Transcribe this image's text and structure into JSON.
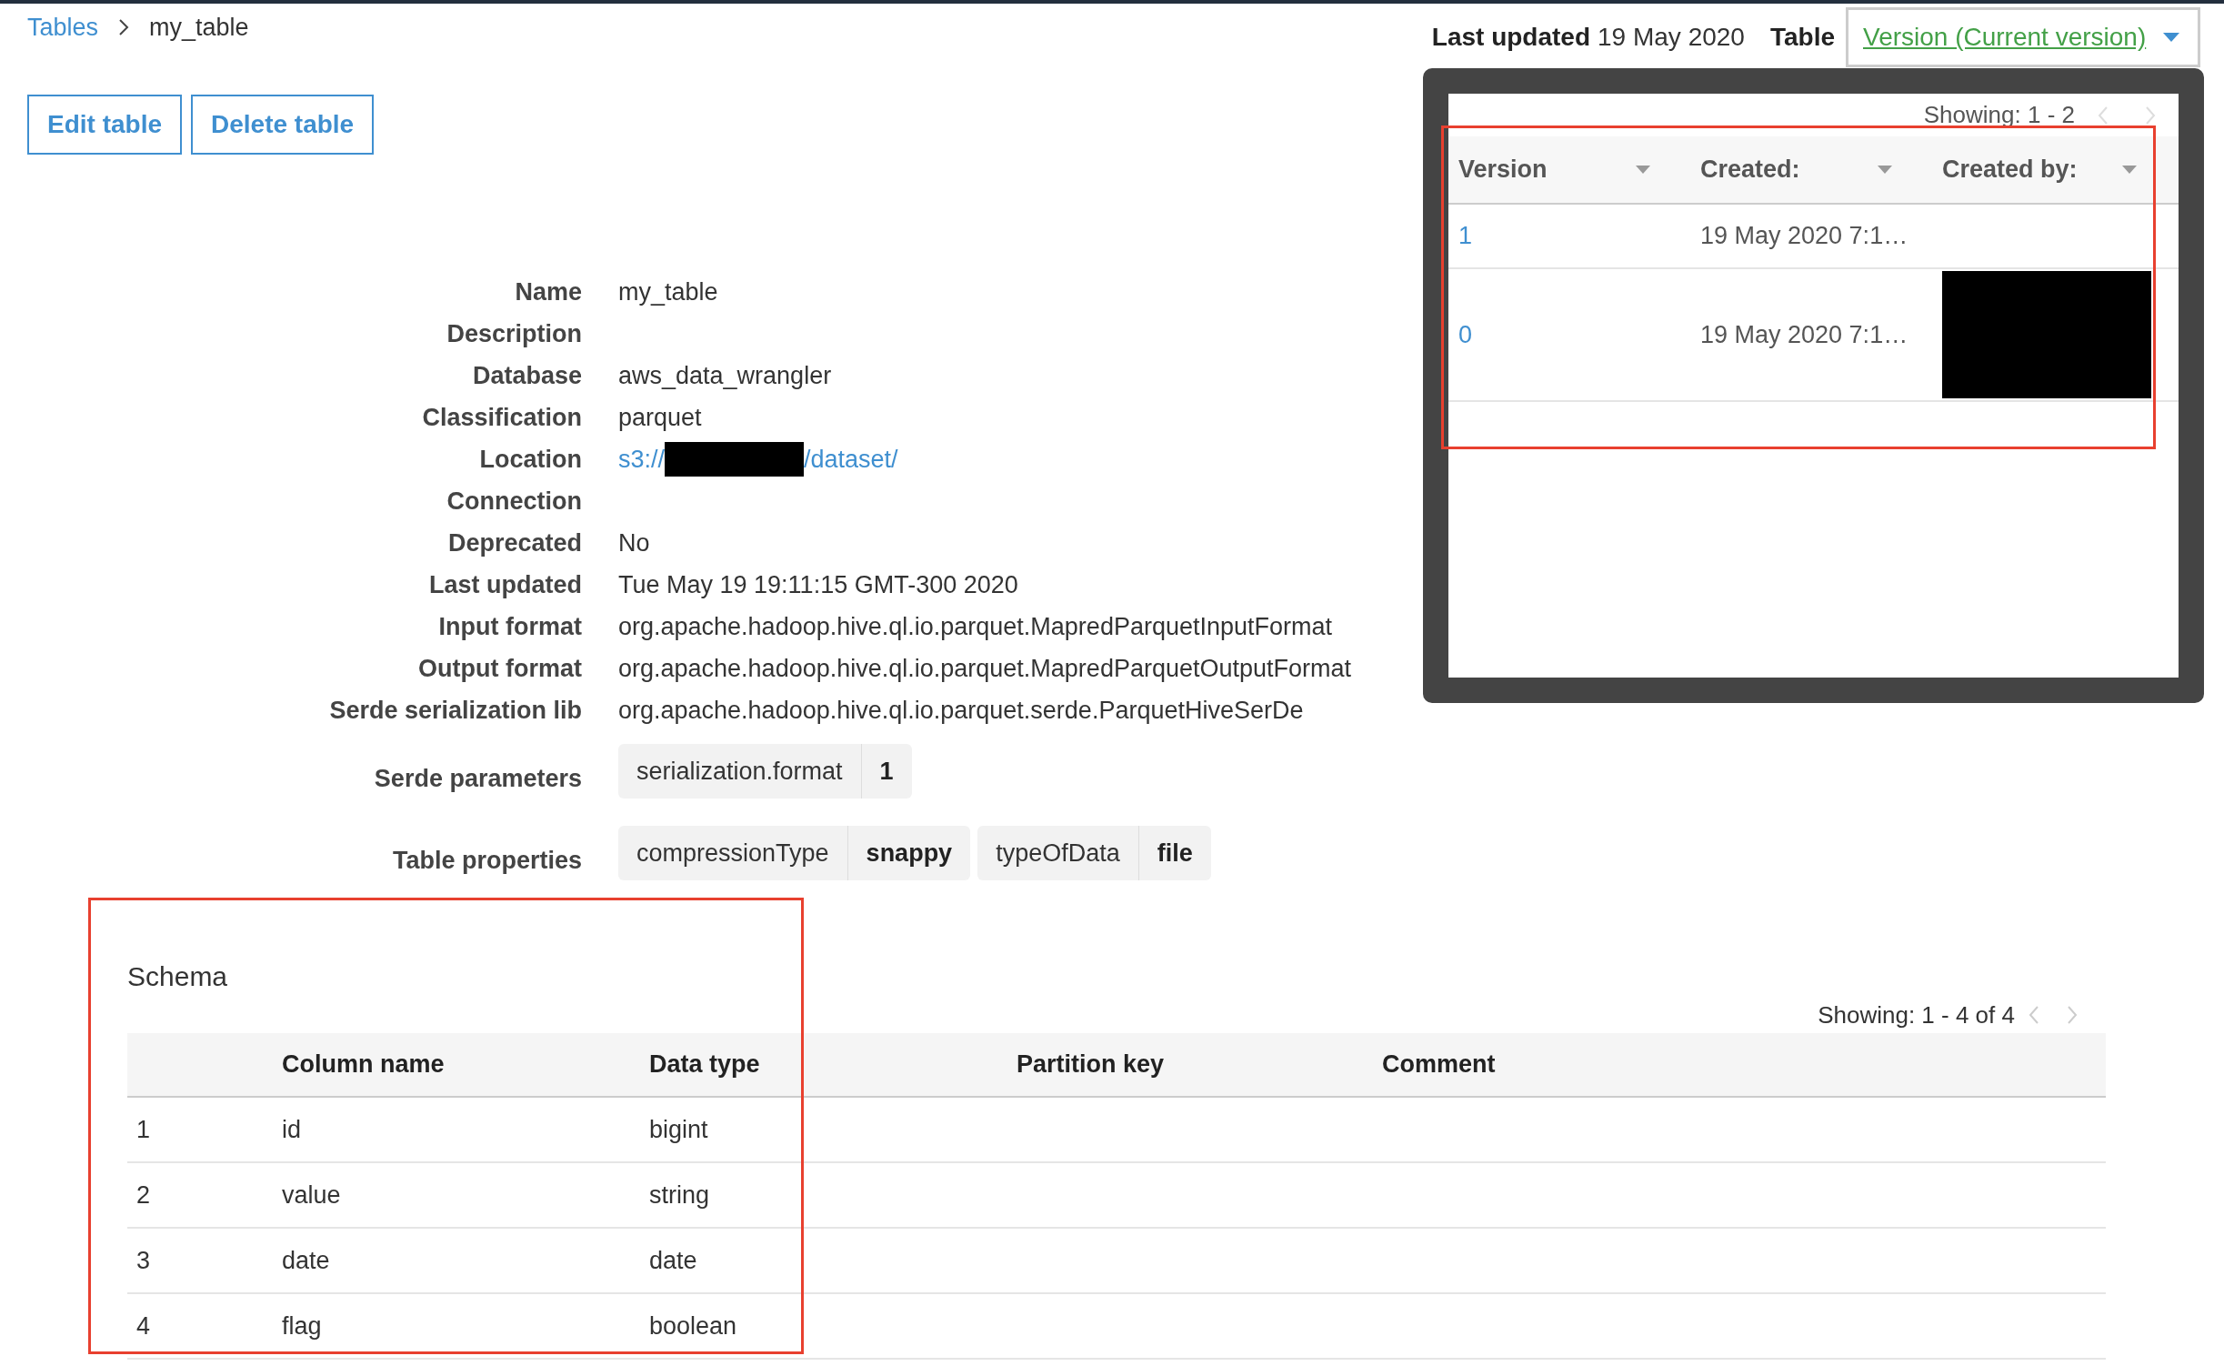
{
  "breadcrumb": [
    {
      "label": "Tables",
      "kind": "link"
    },
    {
      "label": "my_table",
      "kind": "current"
    }
  ],
  "actions": [
    "Edit table",
    "Delete table"
  ],
  "header": {
    "last_updated_label": "Last updated",
    "last_updated_value": "19 May 2020",
    "table_label": "Table",
    "version_dropdown": "Version (Current version)"
  },
  "versions_popover": {
    "showing": "Showing: 1 - 2",
    "columns": [
      "Version",
      "Created:",
      "Created by:"
    ],
    "rows": [
      {
        "version": "1",
        "created": "19 May 2020 7:1…",
        "redacted": false
      },
      {
        "version": "0",
        "created": "19 May 2020 7:1…",
        "redacted": true
      }
    ]
  },
  "details": [
    {
      "label": "Name",
      "kind": "text",
      "value": "my_table"
    },
    {
      "label": "Description",
      "kind": "text"
    },
    {
      "label": "Database",
      "kind": "text",
      "value": "aws_data_wrangler"
    },
    {
      "label": "Classification",
      "kind": "text",
      "value": "parquet"
    },
    {
      "label": "Location",
      "kind": "redacted_link",
      "value_before": "s3://",
      "value_after": "/dataset/"
    },
    {
      "label": "Connection",
      "kind": "text"
    },
    {
      "label": "Deprecated",
      "kind": "text",
      "value": "No"
    },
    {
      "label": "Last updated",
      "kind": "text",
      "value": "Tue May 19 19:11:15 GMT-300 2020"
    },
    {
      "label": "Input format",
      "kind": "text",
      "value": "org.apache.hadoop.hive.ql.io.parquet.MapredParquetInputFormat"
    },
    {
      "label": "Output format",
      "kind": "text",
      "value": "org.apache.hadoop.hive.ql.io.parquet.MapredParquetOutputFormat"
    },
    {
      "label": "Serde serialization lib",
      "kind": "text",
      "value": "org.apache.hadoop.hive.ql.io.parquet.serde.ParquetHiveSerDe"
    },
    {
      "label": "Serde parameters",
      "kind": "pairs",
      "pairs": [
        {
          "key": "serialization.format",
          "value": "1"
        }
      ]
    },
    {
      "label": "Table properties",
      "kind": "pairs",
      "pairs": [
        {
          "key": "compressionType",
          "value": "snappy"
        },
        {
          "key": "typeOfData",
          "value": "file"
        }
      ]
    }
  ],
  "schema": {
    "title": "Schema",
    "showing": "Showing: 1 - 4 of 4",
    "columns": [
      "Column name",
      "Data type",
      "Partition key",
      "Comment"
    ],
    "rows": [
      {
        "index": "1",
        "name": "id",
        "type": "bigint"
      },
      {
        "index": "2",
        "name": "value",
        "type": "string"
      },
      {
        "index": "3",
        "name": "date",
        "type": "date"
      },
      {
        "index": "4",
        "name": "flag",
        "type": "boolean"
      }
    ]
  }
}
